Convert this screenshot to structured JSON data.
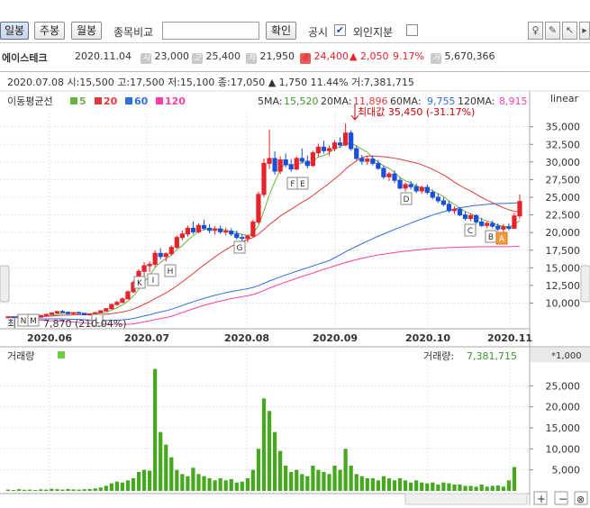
{
  "toolbar": {
    "btn_daily": "일봉",
    "btn_weekly": "주봉",
    "btn_monthly": "월봉",
    "compare_label": "종목비교",
    "compare_value": "",
    "confirm": "확인",
    "disclosure": "공시",
    "disclosure_checked": "✔",
    "foreign": "외인지분"
  },
  "info": {
    "name": "에이스테크",
    "date": "2020.11.04",
    "v1": "23,000",
    "v2": "25,400",
    "v3": "21,950",
    "close": "24,400",
    "change": "▲ 2,050",
    "pct": "9.17%",
    "volume": "5,670,366"
  },
  "ohlc_line": "2020.07.08 시:15,500 고:17,500 저:15,100 종:17,050 ▲ 1,750  11.44% 거:7,381,715",
  "ma": {
    "title": "이동평균선",
    "legend": [
      "5",
      "20",
      "60",
      "120"
    ],
    "colors": [
      "#6db33f",
      "#e03b3b",
      "#2f6fe0",
      "#ff3fa4"
    ],
    "readout": {
      "ma5_label": "5MA:",
      "ma5": "15,520",
      "ma20_label": "20MA:",
      "ma20": "11,896",
      "ma60_label": "60MA:",
      "ma60": "9,755",
      "ma120_label": "120MA:",
      "ma120": "8,915"
    },
    "scale": "linear"
  },
  "annotations": {
    "max": "최대값 35,450 (-31.17%)",
    "min": "7,870 (210.04%)",
    "min_prefix": "최"
  },
  "price_axis": [
    "35,000",
    "32,500",
    "30,000",
    "27,500",
    "25,000",
    "22,500",
    "20,000",
    "17,500",
    "15,000",
    "12,500",
    "10,000"
  ],
  "x_axis": [
    "2020.06",
    "2020.07",
    "2020.08",
    "2020.09",
    "2020.10",
    "2020.11"
  ],
  "markers": [
    "K",
    "I",
    "H",
    "G",
    "F",
    "E",
    "D",
    "C",
    "B",
    "A",
    "N",
    "M",
    "L"
  ],
  "volume_panel": {
    "title": "거래량",
    "readout_label": "거래량:",
    "readout": "7,381,715",
    "unit": "*1,000",
    "axis": [
      "25,000",
      "20,000",
      "15,000",
      "10,000",
      "5,000"
    ]
  },
  "chart_data": {
    "type": "candlestick",
    "candles": [
      [
        8000,
        8100,
        7900,
        8050
      ],
      [
        8050,
        8150,
        7950,
        8000
      ],
      [
        8000,
        8200,
        7950,
        8150
      ],
      [
        8150,
        8300,
        8000,
        8100
      ],
      [
        8100,
        8200,
        7900,
        7950
      ],
      [
        7950,
        8050,
        7870,
        8000
      ],
      [
        8000,
        8300,
        7950,
        8250
      ],
      [
        8250,
        8500,
        8200,
        8400
      ],
      [
        8400,
        8700,
        8350,
        8600
      ],
      [
        8600,
        8900,
        8500,
        8800
      ],
      [
        8800,
        9000,
        8600,
        8700
      ],
      [
        8700,
        8800,
        8400,
        8500
      ],
      [
        8500,
        8700,
        8400,
        8650
      ],
      [
        8650,
        8800,
        8500,
        8550
      ],
      [
        8550,
        8600,
        8300,
        8350
      ],
      [
        8350,
        8500,
        8250,
        8450
      ],
      [
        8450,
        8700,
        8400,
        8650
      ],
      [
        8650,
        9000,
        8600,
        8900
      ],
      [
        8900,
        9300,
        8850,
        9200
      ],
      [
        9200,
        9900,
        9100,
        9800
      ],
      [
        9800,
        10300,
        9600,
        10100
      ],
      [
        10100,
        10800,
        10000,
        10600
      ],
      [
        10600,
        11800,
        10500,
        11600
      ],
      [
        11600,
        13200,
        11400,
        12900
      ],
      [
        12900,
        14800,
        12700,
        14500
      ],
      [
        14500,
        15800,
        13800,
        15300
      ],
      [
        15300,
        15900,
        14400,
        15500
      ],
      [
        15500,
        17500,
        15100,
        17050
      ],
      [
        17050,
        17800,
        16200,
        16600
      ],
      [
        16600,
        17200,
        15900,
        17000
      ],
      [
        17000,
        18200,
        16700,
        17900
      ],
      [
        17900,
        19600,
        17700,
        19300
      ],
      [
        19300,
        20300,
        18900,
        19800
      ],
      [
        19800,
        21000,
        19400,
        20600
      ],
      [
        20600,
        21600,
        19800,
        20100
      ],
      [
        20100,
        21300,
        19900,
        21000
      ],
      [
        21000,
        21800,
        20300,
        20600
      ],
      [
        20600,
        21200,
        19900,
        20300
      ],
      [
        20300,
        20900,
        19700,
        20500
      ],
      [
        20500,
        21000,
        19800,
        20100
      ],
      [
        20100,
        20700,
        19600,
        20200
      ],
      [
        20200,
        20600,
        19500,
        19800
      ],
      [
        19800,
        20300,
        19000,
        19300
      ],
      [
        19300,
        19800,
        18700,
        19200
      ],
      [
        19200,
        19700,
        18600,
        19500
      ],
      [
        19500,
        21800,
        19300,
        21500
      ],
      [
        21500,
        25800,
        21200,
        25400
      ],
      [
        25400,
        30500,
        25000,
        29800
      ],
      [
        29800,
        34600,
        29000,
        30500
      ],
      [
        30500,
        31500,
        28200,
        28700
      ],
      [
        28700,
        30800,
        28300,
        30300
      ],
      [
        30300,
        31200,
        29200,
        29600
      ],
      [
        29600,
        30400,
        28600,
        29000
      ],
      [
        29000,
        30800,
        28800,
        30500
      ],
      [
        30500,
        31900,
        29800,
        30100
      ],
      [
        30100,
        30900,
        29100,
        29500
      ],
      [
        29500,
        31600,
        29300,
        31300
      ],
      [
        31300,
        32600,
        30700,
        32100
      ],
      [
        32100,
        33000,
        31200,
        31600
      ],
      [
        31600,
        32300,
        30900,
        31900
      ],
      [
        31900,
        33100,
        31500,
        32700
      ],
      [
        32700,
        33500,
        32000,
        32400
      ],
      [
        32400,
        35450,
        32300,
        34100
      ],
      [
        34100,
        34500,
        31600,
        31900
      ],
      [
        31900,
        32300,
        30300,
        30500
      ],
      [
        30500,
        31000,
        29600,
        30100
      ],
      [
        30100,
        30800,
        29600,
        30400
      ],
      [
        30400,
        30900,
        29500,
        29800
      ],
      [
        29800,
        30300,
        28900,
        29100
      ],
      [
        29100,
        29500,
        27600,
        27900
      ],
      [
        27900,
        28600,
        27300,
        28300
      ],
      [
        28300,
        28800,
        27000,
        27400
      ],
      [
        27400,
        27800,
        26100,
        26300
      ],
      [
        26300,
        27100,
        25800,
        26800
      ],
      [
        26800,
        27300,
        26100,
        26500
      ],
      [
        26500,
        26900,
        25600,
        25900
      ],
      [
        25900,
        26700,
        25500,
        26400
      ],
      [
        26400,
        26800,
        25400,
        25700
      ],
      [
        25700,
        26100,
        24700,
        25000
      ],
      [
        25000,
        25500,
        24200,
        24500
      ],
      [
        24500,
        25000,
        23700,
        24000
      ],
      [
        24000,
        24500,
        22800,
        23100
      ],
      [
        23100,
        23700,
        22600,
        23300
      ],
      [
        23300,
        23600,
        22300,
        22500
      ],
      [
        22500,
        23000,
        21700,
        22000
      ],
      [
        22000,
        22700,
        21600,
        22400
      ],
      [
        22400,
        22600,
        21200,
        21500
      ],
      [
        21500,
        22100,
        20800,
        21000
      ],
      [
        21000,
        21600,
        20600,
        21300
      ],
      [
        21300,
        21700,
        20600,
        20900
      ],
      [
        20900,
        21300,
        20200,
        20500
      ],
      [
        20500,
        21200,
        20100,
        20800
      ],
      [
        20800,
        21300,
        20300,
        20600
      ],
      [
        20600,
        22800,
        20500,
        22350
      ],
      [
        22350,
        25400,
        21950,
        24400
      ]
    ],
    "volumes": [
      300,
      200,
      400,
      250,
      300,
      200,
      350,
      300,
      500,
      400,
      300,
      450,
      350,
      300,
      400,
      450,
      600,
      800,
      1200,
      1800,
      2200,
      2000,
      2500,
      3000,
      4500,
      5000,
      4800,
      29000,
      14000,
      11000,
      8000,
      5000,
      4000,
      3500,
      5500,
      4000,
      3500,
      3000,
      2500,
      3000,
      2500,
      2800,
      2000,
      2200,
      3000,
      5000,
      10000,
      22000,
      19000,
      14000,
      9500,
      6000,
      4500,
      5000,
      4000,
      3500,
      6000,
      5000,
      4500,
      4000,
      6000,
      5000,
      10000,
      6000,
      4000,
      3500,
      3000,
      3000,
      2500,
      3500,
      3000,
      2500,
      3000,
      2500,
      2000,
      2500,
      2000,
      1800,
      2000,
      1500,
      2000,
      1800,
      1500,
      1500,
      1200,
      1200,
      1000,
      1500,
      1000,
      1200,
      1300,
      1000,
      2500,
      5670
    ],
    "ylim": [
      7000,
      37000
    ],
    "vol_ylim": [
      0,
      30000
    ]
  }
}
